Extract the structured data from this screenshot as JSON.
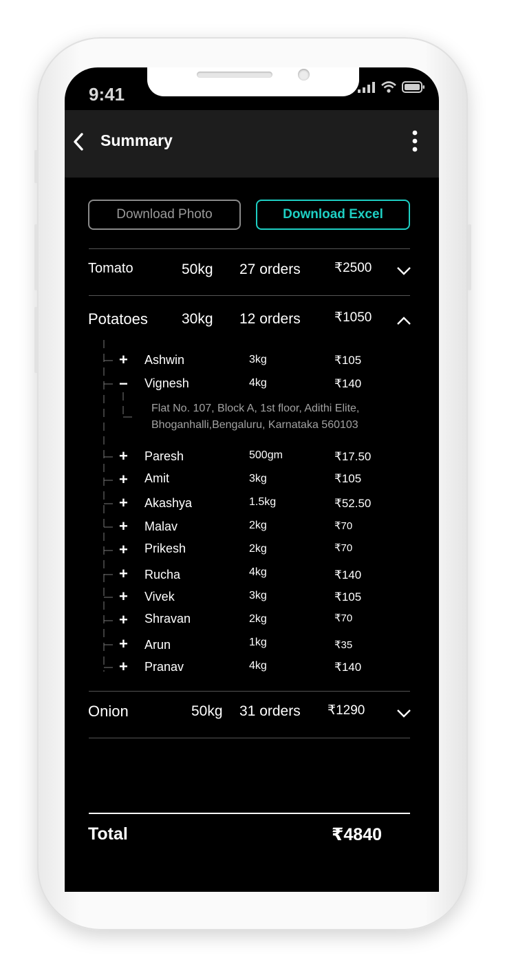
{
  "status_bar": {
    "time": "9:41"
  },
  "header": {
    "title": "Summary"
  },
  "actions": {
    "download_photo": "Download Photo",
    "download_excel": "Download Excel"
  },
  "products": [
    {
      "name": "Tomato",
      "quantity": "50kg",
      "orders": "27 orders",
      "amount": "₹2500",
      "expanded": false
    },
    {
      "name": "Potatoes",
      "quantity": "30kg",
      "orders": "12 orders",
      "amount": "₹1050",
      "expanded": true,
      "customers": [
        {
          "name": "Ashwin",
          "qty": "3kg",
          "price": "₹105"
        },
        {
          "name": "Vignesh",
          "qty": "4kg",
          "price": "₹140",
          "address_line1": "Flat No. 107, Block A, 1st floor, Adithi Elite,",
          "address_line2": "Bhoganhalli,Bengaluru, Karnataka 560103"
        },
        {
          "name": "Paresh",
          "qty": "500gm",
          "price": "₹17.50"
        },
        {
          "name": "Amit",
          "qty": "3kg",
          "price": "₹105"
        },
        {
          "name": "Akashya",
          "qty": "1.5kg",
          "price": "₹52.50"
        },
        {
          "name": "Malav",
          "qty": "2kg",
          "price": "₹70"
        },
        {
          "name": "Prikesh",
          "qty": "2kg",
          "price": "₹70"
        },
        {
          "name": "Rucha",
          "qty": "4kg",
          "price": "₹140"
        },
        {
          "name": "Vivek",
          "qty": "3kg",
          "price": "₹105"
        },
        {
          "name": "Shravan",
          "qty": "2kg",
          "price": "₹70"
        },
        {
          "name": "Arun",
          "qty": "1kg",
          "price": "₹35"
        },
        {
          "name": "Pranav",
          "qty": "4kg",
          "price": "₹140"
        }
      ]
    },
    {
      "name": "Onion",
      "quantity": "50kg",
      "orders": "31 orders",
      "amount": "₹1290",
      "expanded": false
    }
  ],
  "expand_symbol": "+",
  "collapse_symbol": "−",
  "total": {
    "label": "Total",
    "value": "₹4840"
  },
  "colors": {
    "accent": "#1ecfc3",
    "background": "#000000",
    "header": "#1d1d1d",
    "muted": "#9a9a9a"
  }
}
